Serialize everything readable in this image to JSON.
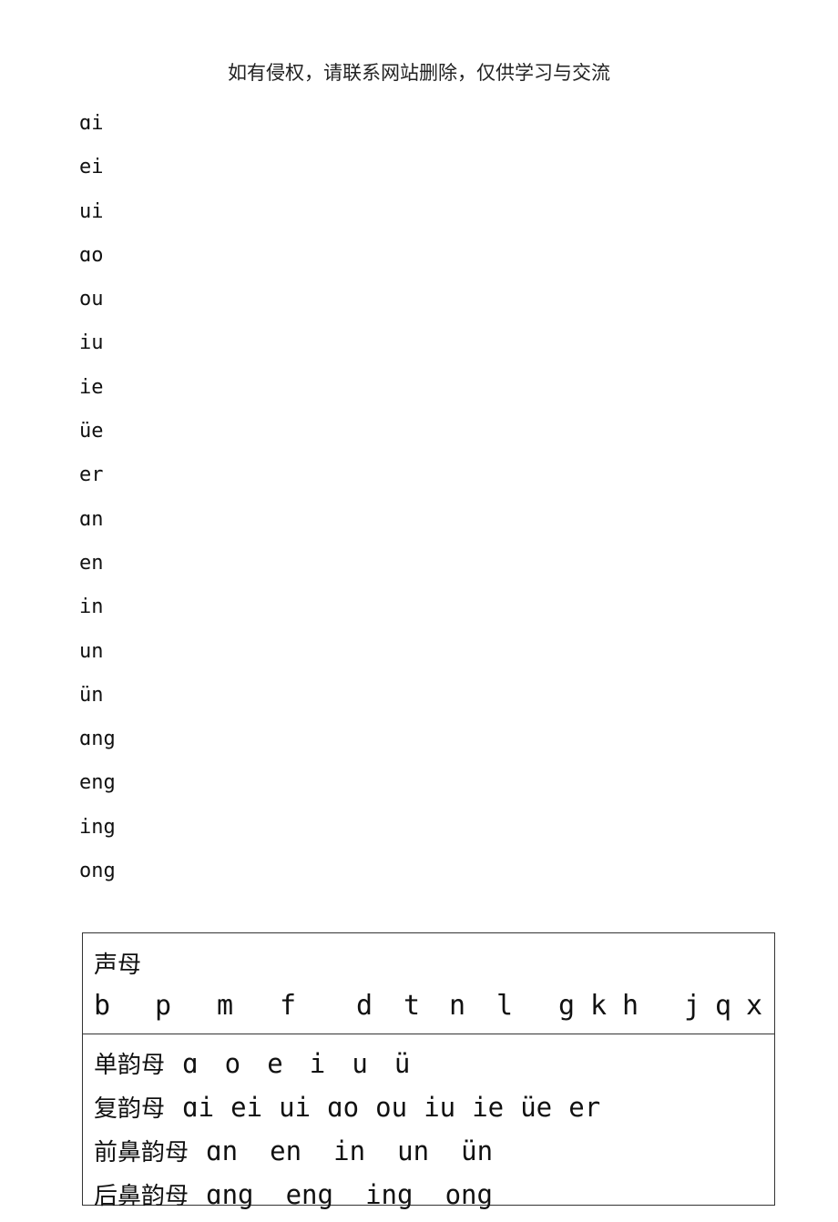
{
  "header": {
    "notice": "如有侵权，请联系网站删除，仅供学习与交流"
  },
  "finals_list": [
    "ɑi",
    "ei",
    "ui",
    "ɑo",
    "ou",
    "iu",
    "ie",
    "üe",
    "er",
    "ɑn",
    "en",
    "in",
    "un",
    "ün",
    "ɑng",
    "eng",
    "ing",
    "ong"
  ],
  "table": {
    "initials": {
      "label": "声母",
      "letters": [
        "b",
        "p",
        "m",
        "f",
        "d",
        "t",
        "n",
        "l",
        "g",
        "k",
        "h",
        "j",
        "q",
        "x"
      ]
    },
    "finals_rows": [
      {
        "label": "单韵母",
        "items": [
          "ɑ",
          "o",
          "e",
          "i",
          "u",
          "ü"
        ]
      },
      {
        "label": "复韵母",
        "items": [
          "ɑi",
          "ei",
          "ui",
          "ɑo",
          "ou",
          "iu",
          "ie",
          "üe",
          "er"
        ]
      },
      {
        "label": "前鼻韵母",
        "items": [
          "ɑn",
          "en",
          "in",
          "un",
          "ün"
        ]
      },
      {
        "label": "后鼻韵母",
        "items": [
          "ɑng",
          "eng",
          "ing",
          "ong"
        ]
      }
    ]
  }
}
